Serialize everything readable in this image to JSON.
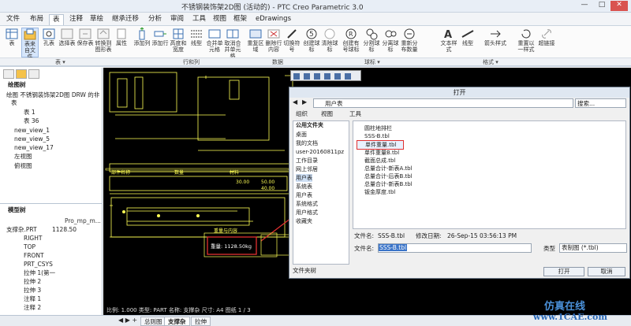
{
  "window": {
    "title": "不锈钢装饰架2D图 (活动的) - PTC Creo Parametric 3.0",
    "min": "—",
    "max": "□",
    "close": "✕"
  },
  "menu": {
    "tabs": [
      "文件",
      "布局",
      "表",
      "注释",
      "草绘",
      "继承迁移",
      "分析",
      "审阅",
      "工具",
      "视图",
      "框架",
      "eDrawings"
    ]
  },
  "ribbon": {
    "buttons": [
      "表",
      "表来自文件",
      "孔表",
      "选择表",
      "保存表",
      "转换到图形表",
      "属性",
      "添加列",
      "添加行",
      "高度和宽度",
      "线型",
      "合并单元格",
      "取消合并单元格",
      "重复区域",
      "删除行内容",
      "切换符号",
      "创建球标",
      "清除球标",
      "创建有号球标",
      "分割球标",
      "分离球标",
      "重新分布数量",
      "文本样式",
      "线型",
      "箭头样式",
      "重置以一样式",
      "超链接"
    ],
    "groups": {
      "table": "表 ▾",
      "rowcol": "行和列",
      "data": "数据",
      "balloons": "球标 ▾",
      "format": "格式 ▾"
    }
  },
  "left_panel": {
    "drawing_tree_label": "绘图树",
    "drawing_items": [
      "绘图 不锈钢装饰架2D图 DRW 的非",
      "表",
      "表 1",
      "表 36",
      "new_view_1",
      "new_view_5",
      "new_view_17",
      "左视图",
      "俯视图"
    ],
    "model_tree_label": "模型树",
    "col_header": "Pro_mp_m...",
    "model_items": [
      "支撑杂.PRT",
      "RIGHT",
      "TOP",
      "FRONT",
      "PRT_CSYS",
      "拉伸 1(第一",
      "拉伸 2",
      "拉伸 3",
      "注释 1",
      "注释 2"
    ],
    "model_value": "1128.50"
  },
  "dialog": {
    "title": "打开",
    "address": "用户表",
    "search_placeholder": "搜索...",
    "toolbar": {
      "organize": "组织",
      "views": "视图",
      "tools": "工具"
    },
    "folders_header": "公用文件夹",
    "folders": [
      "桌面",
      "我的文档",
      "user-20160811pz",
      "工作目录",
      "网上邻居",
      "用户表",
      "系统表",
      "用户表",
      "系统格式",
      "用户格式",
      "收藏夹"
    ],
    "folder_tree_label": "文件夹树",
    "files": [
      "圆柱地排栏",
      "SSS-B.tbl",
      "单件重量.tbl",
      "单件重量B.tbl",
      "截面总成.tbl",
      "总量合计-新表A.tbl",
      "总量合计-后表B.tbl",
      "总量合计-新表B.tbl",
      "钣金厚度.tbl"
    ],
    "selected_file_index": 2,
    "file_name_label": "文件名:",
    "file_name_value": "SSS-B.tbl",
    "modified_label": "修改日期:",
    "modified_value": "26-Sep-15 03:56:13 PM",
    "file_input_label": "文件名:",
    "file_input_value": "SSS-B.tbl",
    "type_label": "类型",
    "type_value": "表制图 (*.tbl)",
    "open_button": "打开",
    "cancel_button": "取消"
  },
  "drawing": {
    "dims": [
      "1128.50",
      "30.00",
      "50.00",
      "40.00",
      "8",
      "3"
    ],
    "tag": "重量: 1128.50kg",
    "weight_table_title": "重量与内容",
    "labels": [
      "部件名称",
      "数量",
      "材料"
    ]
  },
  "status": {
    "text": "比例: 1.000    类型: PART    名称: 支撑杂    尺寸: A4    图纸 1 / 3"
  },
  "bottom": {
    "tabs": [
      "总则图",
      "支撑杂",
      "拉伸"
    ]
  },
  "watermark": {
    "cn": "仿真在线",
    "url": "www.1CAE.com"
  },
  "colors": {
    "accent": "#e03030",
    "cad": "#ffff55",
    "select": "#3a74c9"
  }
}
